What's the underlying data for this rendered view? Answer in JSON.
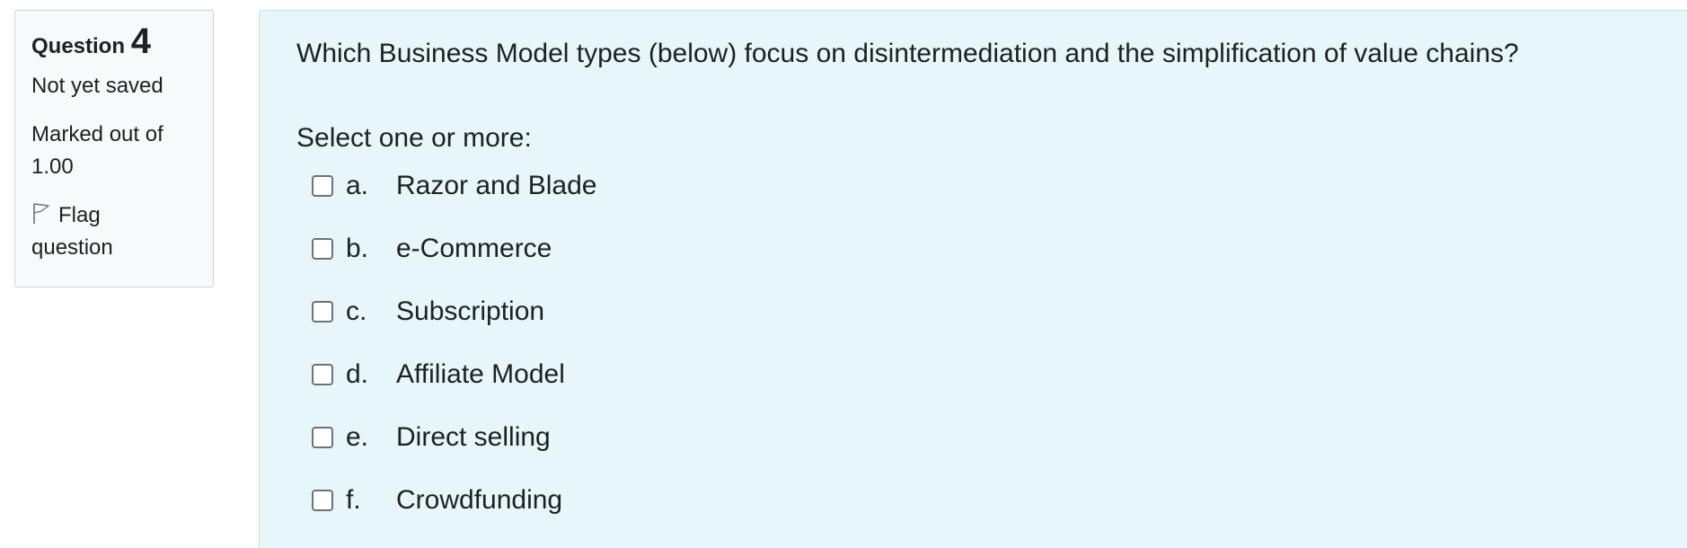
{
  "info": {
    "question_label": "Question",
    "question_number": "4",
    "state": "Not yet saved",
    "grade": "Marked out of 1.00",
    "flag_label": "Flag question",
    "flag_icon": "flag-outline-icon"
  },
  "question": {
    "text": "Which Business Model types (below) focus on disintermediation and the simplification of value chains?",
    "prompt": "Select one or more:",
    "answers": [
      {
        "letter": "a.",
        "label": "Razor and Blade",
        "checked": false
      },
      {
        "letter": "b.",
        "label": "e-Commerce",
        "checked": false
      },
      {
        "letter": "c.",
        "label": "Subscription",
        "checked": false
      },
      {
        "letter": "d.",
        "label": "Affiliate Model",
        "checked": false
      },
      {
        "letter": "e.",
        "label": "Direct selling",
        "checked": false
      },
      {
        "letter": "f.",
        "label": "Crowdfunding",
        "checked": false
      }
    ]
  },
  "colors": {
    "info_bg": "#f8f9fa",
    "content_bg": "#e7f6f8",
    "content_border": "#b8e4ea",
    "text": "#1d2125"
  }
}
